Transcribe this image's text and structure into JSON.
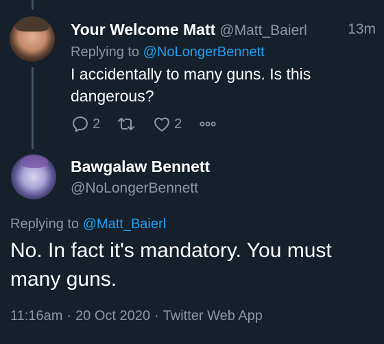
{
  "tweet1": {
    "author_name": "Your Welcome Matt",
    "handle": "@Matt_Baierl",
    "time": "13m",
    "replying_prefix": "Replying to",
    "replying_to": "@NoLongerBennett",
    "text": "I accidentally to many guns. Is this dangerous?",
    "reply_count": "2",
    "like_count": "2"
  },
  "tweet2": {
    "author_name": "Bawgalaw Bennett",
    "handle": "@NoLongerBennett",
    "replying_prefix": "Replying to",
    "replying_to": "@Matt_Baierl",
    "text": "No. In fact it's mandatory. You must many guns.",
    "time": "11:16am",
    "date": "20 Oct 2020",
    "source": "Twitter Web App"
  },
  "colors": {
    "background": "#15202b",
    "secondary_text": "#8899a6",
    "link": "#1da1f2"
  }
}
